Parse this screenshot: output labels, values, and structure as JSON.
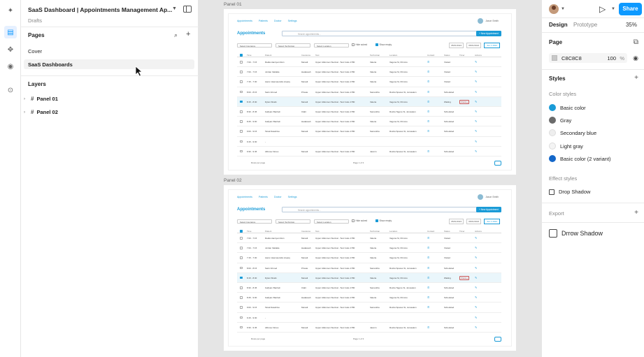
{
  "file": {
    "title": "SaaS Dashboard | Appointments Management Ap...",
    "location": "Drafts"
  },
  "pages": {
    "heading": "Pages",
    "items": [
      {
        "label": "Cover",
        "selected": false
      },
      {
        "label": "SaaS Dashboards",
        "selected": true
      }
    ]
  },
  "layers": {
    "heading": "Layers",
    "items": [
      {
        "label": "Panel 01"
      },
      {
        "label": "Panel 02"
      }
    ]
  },
  "canvas": {
    "frames": [
      {
        "label": "Panel 01"
      },
      {
        "label": "Panel 02"
      }
    ]
  },
  "mock": {
    "nav": [
      "Appointments",
      "Patients",
      "Doctor",
      "Settings"
    ],
    "user": "Jason Smith",
    "title": "Appointments",
    "search_placeholder": "Search appointments...",
    "new_button": "+ New Appointment",
    "filters": [
      "Select Insurance",
      "Select Technician",
      "Select Location"
    ],
    "check_hide": "Hide solved",
    "check_show": "Show empty",
    "date_from": "05/01/2024",
    "date_to": "05/01/2024",
    "today": "Jun 1 2024",
    "columns": [
      "Time",
      "Patient",
      "Insurance",
      "Test",
      "Technician",
      "Location",
      "Contact",
      "Status",
      "Timer",
      "Actions"
    ],
    "rows": [
      {
        "time": "7:00 - 7:15",
        "patient": "Radia Hamiyan Rein",
        "ins": "Meradi",
        "test": "Upper Abdomen Sterinal - Test Code 1780",
        "tech": "Valeria",
        "loc": "Vaguna St, PA Ams",
        "status": "Visited",
        "tag": "",
        "checked": false
      },
      {
        "time": "7:00 - 7:15",
        "patient": "Jordan Valdalia",
        "ins": "Hadassah",
        "test": "Upper Abdomen Sterinal - Test Code 1780",
        "tech": "Valeria",
        "loc": "Vaguna St, PA Ams",
        "status": "Visited",
        "tag": "",
        "checked": false
      },
      {
        "time": "7:15 - 7:30",
        "patient": "Aaron Hasmaunidio Areaiq",
        "ins": "Meradi",
        "test": "Upper Abdomen Sterinal - Test Code 1780",
        "tech": "Valeria",
        "loc": "Vaguna St, PA Ams",
        "status": "Visited",
        "tag": "",
        "checked": false
      },
      {
        "time": "8:00 - 8:15",
        "patient": "Sarin Ahmed",
        "ins": "Private",
        "test": "Upper Abdomen Sterinal - Test Code 1780",
        "tech": "Samantha",
        "loc": "Rosha Spaces St, Jerusalem",
        "status": "Scheduled",
        "tag": "",
        "checked": false
      },
      {
        "time": "8:15 - 8:30",
        "patient": "Dylan Shalin",
        "ins": "Meradi",
        "test": "Upper Abdomen Sterinal - Test Code 1780",
        "tech": "Valeria",
        "loc": "Vaguna St, PA Ams",
        "status": "Waiting",
        "tag": "Waiting",
        "checked": true
      },
      {
        "time": "8:30 - 8:45",
        "patient": "Gallyam Banbeli",
        "ins": "Clalit",
        "test": "Upper Abdomen Sterinal - Test Code 1780",
        "tech": "Samantha",
        "loc": "Rosha Tagore St, Jerusalem",
        "status": "Scheduled",
        "tag": "",
        "checked": false
      },
      {
        "time": "8:45 - 9:00",
        "patient": "Gallyam Banbeli",
        "ins": "Hadassah",
        "test": "Upper Abdomen Sterinal - Test Code 1780",
        "tech": "Valeria",
        "loc": "Vaguna St, PA Ams",
        "status": "Scheduled",
        "tag": "",
        "checked": false
      },
      {
        "time": "9:00 - 9:15",
        "patient": "Tarak Dasahiva",
        "ins": "Meradi",
        "test": "Upper Abdomen Sterinal - Test Code 1780",
        "tech": "Samantha",
        "loc": "Rosha Spaces St, Jerusalem",
        "status": "Scheduled",
        "tag": "",
        "checked": false
      },
      {
        "time": "9:15 - 9:30",
        "patient": "-",
        "ins": "",
        "test": "",
        "tech": "",
        "loc": "",
        "status": "",
        "tag": "",
        "checked": false
      },
      {
        "time": "9:30 - 9:45",
        "patient": "Albrose Flores",
        "ins": "Meradi",
        "test": "Upper Abdomen Sterinal - Test Code 1780",
        "tech": "Jasmin",
        "loc": "Rosha Spaces St, Jerusalem",
        "status": "Scheduled",
        "tag": "",
        "checked": false
      }
    ],
    "pager_left": "Rows per page",
    "pager_mid": "Page 1 of 3"
  },
  "right": {
    "share": "Share",
    "tabs": [
      "Design",
      "Prototype"
    ],
    "zoom": "35%",
    "page_heading": "Page",
    "page_fill_hex": "C8C8C8",
    "page_fill_pct": "100",
    "page_fill_unit": "%",
    "styles_heading": "Styles",
    "color_styles_heading": "Color styles",
    "colors": [
      {
        "label": "Basic color",
        "color": "#1a9bd7"
      },
      {
        "label": "Gray",
        "color": "#6b6b6b"
      },
      {
        "label": "Secondary blue",
        "color": "#eeeeee"
      },
      {
        "label": "Light gray",
        "color": "#f4f4f4"
      },
      {
        "label": "Basic color (2 variant)",
        "color": "#1467c9"
      }
    ],
    "effect_styles_heading": "Effect styles",
    "effect": "Drop Shadow",
    "export_heading": "Export",
    "drop_shadow_item": "Drrow Shadow"
  }
}
